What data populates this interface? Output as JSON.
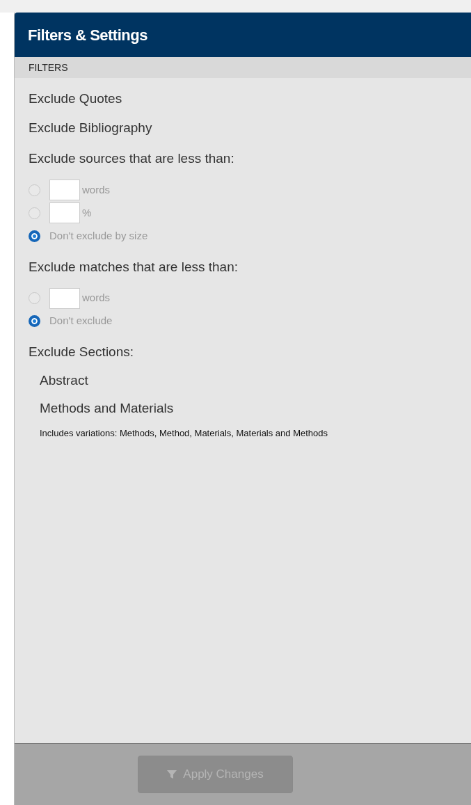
{
  "header": {
    "title": "Filters & Settings"
  },
  "section": {
    "label": "FILTERS"
  },
  "filters": [
    {
      "label": "Exclude Quotes"
    },
    {
      "label": "Exclude Bibliography"
    }
  ],
  "groups": [
    {
      "title": "Exclude sources that are less than:",
      "options": [
        {
          "kind": "input",
          "unit": "words",
          "selected": false
        },
        {
          "kind": "input",
          "unit": "%",
          "selected": false
        },
        {
          "kind": "plain",
          "label": "Don't exclude by size",
          "selected": true
        }
      ]
    },
    {
      "title": "Exclude matches that are less than:",
      "options": [
        {
          "kind": "input",
          "unit": "words",
          "selected": false
        },
        {
          "kind": "plain",
          "label": "Don't exclude",
          "selected": true
        }
      ]
    }
  ],
  "sections": {
    "title": "Exclude Sections:",
    "items": [
      {
        "label": "Abstract"
      },
      {
        "label": "Methods and Materials"
      }
    ],
    "note": "Includes variations: Methods, Method, Materials, Materials and Methods"
  },
  "footer": {
    "button": {
      "label": "Apply Changes",
      "disabled": true
    }
  }
}
